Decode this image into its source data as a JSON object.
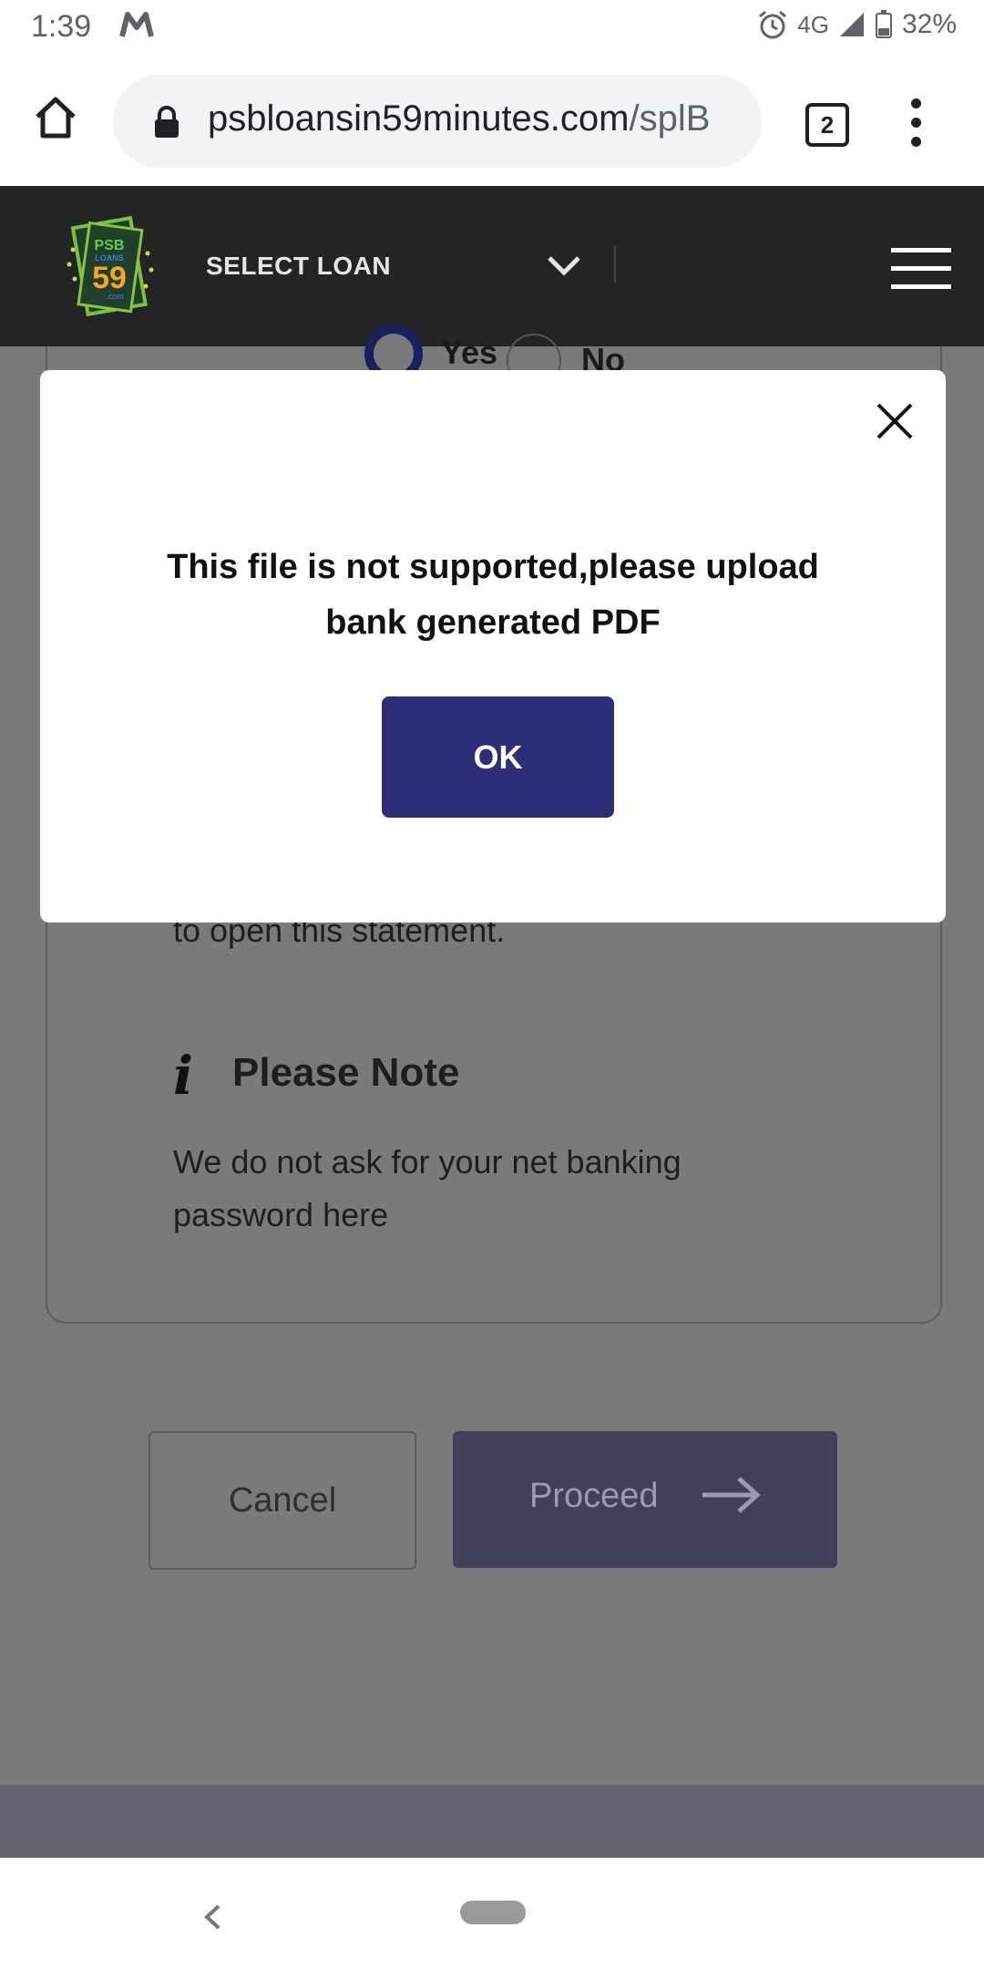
{
  "status_bar": {
    "time": "1:39",
    "network": "4G",
    "battery": "32%"
  },
  "browser": {
    "url_domain": "psbloansin59minutes.com",
    "url_path": "/splB",
    "tab_count": "2"
  },
  "header": {
    "logo": {
      "line1": "PSB",
      "line2": "LOANS",
      "number": "59",
      "suffix": ".com"
    },
    "select_loan": "SELECT LOAN"
  },
  "background": {
    "radio_yes": "Yes",
    "radio_no": "No",
    "hint_text": "to open this statement.",
    "note_icon": "i",
    "note_title": "Please Note",
    "note_text": "We do not ask for your net banking password here",
    "cancel_label": "Cancel",
    "proceed_label": "Proceed"
  },
  "modal": {
    "message": "This file is not supported,please upload bank generated PDF",
    "ok_label": "OK"
  }
}
